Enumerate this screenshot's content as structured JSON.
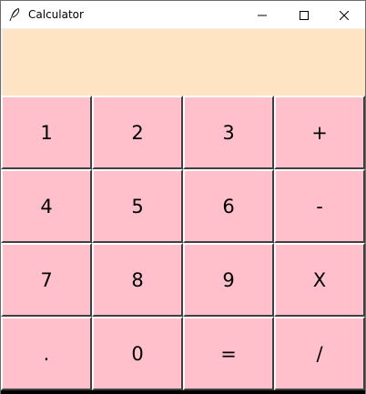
{
  "window": {
    "title": "Calculator"
  },
  "display": {
    "value": ""
  },
  "colors": {
    "display_bg": "#ffe4c4",
    "key_bg": "#ffc0cb"
  },
  "keys": [
    "1",
    "2",
    "3",
    "+",
    "4",
    "5",
    "6",
    "-",
    "7",
    "8",
    "9",
    "X",
    ".",
    "0",
    "=",
    "/"
  ]
}
